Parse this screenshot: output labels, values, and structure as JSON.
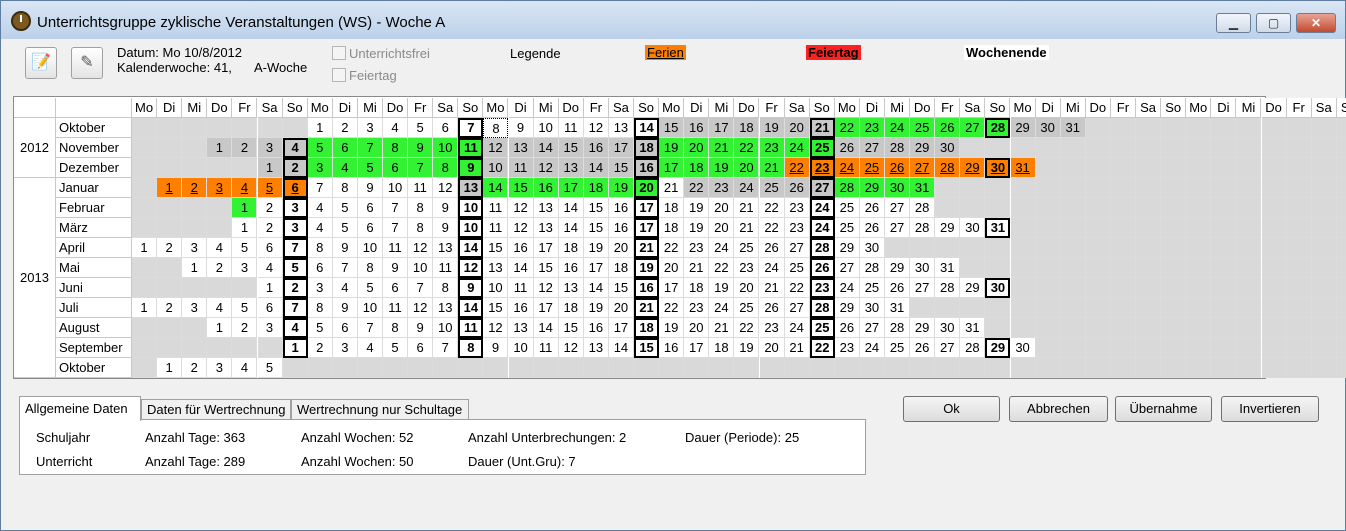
{
  "window": {
    "title": "Unterrichtsgruppe zyklische Veranstaltungen (WS) - Woche A",
    "minimize": "▁",
    "maximize": "▢",
    "close": "✕"
  },
  "toolbar": {
    "datum": "Datum: Mo 10/8/2012",
    "kalenderwoche": "Kalenderwoche: 41,",
    "woche": "A-Woche",
    "unterrichtsfrei": "Unterrichtsfrei",
    "feiertag_cb": "Feiertag",
    "legende": "Legende",
    "ferien": "Ferien",
    "feiertag": "Feiertag",
    "wochenende": "Wochenende",
    "icon1": "notepad-icon",
    "icon2": "pencil-icon"
  },
  "calendar": {
    "weekday_headers": [
      "Mo",
      "Di",
      "Mi",
      "Do",
      "Fr",
      "Sa",
      "So",
      "Mo",
      "Di",
      "Mi",
      "Do",
      "Fr",
      "Sa",
      "So",
      "Mo",
      "Di",
      "Mi",
      "Do",
      "Fr",
      "Sa",
      "So",
      "Mo",
      "Di",
      "Mi",
      "Do",
      "Fr",
      "Sa",
      "So",
      "Mo",
      "Di",
      "Mi",
      "Do",
      "Fr",
      "Sa",
      "So",
      "Mo",
      "Di",
      "Mi",
      "Do",
      "Fr",
      "Sa",
      "So",
      "Mo",
      "Di",
      "Mi",
      "Do",
      "Fr",
      "Sa",
      "So"
    ],
    "years": [
      {
        "label": "2012",
        "rows": 3
      },
      {
        "label": "2013",
        "rows": 10
      }
    ],
    "months": [
      {
        "name": "Oktober",
        "offset": 7,
        "days": 31,
        "green": [
          22,
          23,
          24,
          25,
          26,
          27,
          28
        ],
        "orange": [],
        "grey": [
          15,
          16,
          17,
          18,
          19,
          20,
          21,
          29,
          30,
          31
        ],
        "today": 8
      },
      {
        "name": "November",
        "offset": 3,
        "days": 30,
        "green": [
          5,
          6,
          7,
          8,
          9,
          10,
          11,
          19,
          20,
          21,
          22,
          23,
          24,
          25
        ],
        "orange": [],
        "grey": [
          1,
          2,
          3,
          4,
          12,
          13,
          14,
          15,
          16,
          17,
          18,
          26,
          27,
          28,
          29,
          30
        ]
      },
      {
        "name": "Dezember",
        "offset": 5,
        "days": 31,
        "green": [
          3,
          4,
          5,
          6,
          7,
          8,
          9,
          17,
          18,
          19,
          20,
          21
        ],
        "orange": [
          22,
          23,
          24,
          25,
          26,
          27,
          28,
          29,
          30,
          31
        ],
        "grey": [
          1,
          2,
          10,
          11,
          12,
          13,
          14,
          15,
          16
        ]
      },
      {
        "name": "Januar",
        "offset": 1,
        "days": 31,
        "green": [
          14,
          15,
          16,
          17,
          18,
          19,
          20,
          28,
          29,
          30,
          31
        ],
        "orange": [
          1,
          2,
          3,
          4,
          5,
          6
        ],
        "grey": [
          13,
          22,
          23,
          24,
          25,
          26,
          27
        ]
      },
      {
        "name": "Februar",
        "offset": 4,
        "days": 28,
        "green": [
          1
        ],
        "orange": [],
        "grey": []
      },
      {
        "name": "März",
        "offset": 4,
        "days": 31,
        "green": [],
        "orange": [],
        "grey": []
      },
      {
        "name": "April",
        "offset": 0,
        "days": 30,
        "green": [],
        "orange": [],
        "grey": []
      },
      {
        "name": "Mai",
        "offset": 2,
        "days": 31,
        "green": [],
        "orange": [],
        "grey": []
      },
      {
        "name": "Juni",
        "offset": 5,
        "days": 30,
        "green": [],
        "orange": [],
        "grey": []
      },
      {
        "name": "Juli",
        "offset": 0,
        "days": 31,
        "green": [],
        "orange": [],
        "grey": []
      },
      {
        "name": "August",
        "offset": 3,
        "days": 31,
        "green": [],
        "orange": [],
        "grey": []
      },
      {
        "name": "September",
        "offset": 6,
        "days": 30,
        "green": [],
        "orange": [],
        "grey": []
      },
      {
        "name": "Oktober",
        "offset": 1,
        "days": 5,
        "green": [],
        "orange": [],
        "grey": []
      }
    ]
  },
  "tabs": [
    "Allgemeine Daten",
    "Daten für Wertrechnung",
    "Wertrechnung nur Schultage"
  ],
  "info": {
    "schuljahr": "Schuljahr",
    "schuljahr_tage": "Anzahl Tage: 363",
    "schuljahr_wochen": "Anzahl Wochen: 52",
    "unterbrechungen": "Anzahl Unterbrechungen: 2",
    "dauer_periode": "Dauer (Periode): 25",
    "unterricht": "Unterricht",
    "unterricht_tage": "Anzahl Tage: 289",
    "unterricht_wochen": "Anzahl Wochen: 50",
    "dauer_untgru": "Dauer (Unt.Gru): 7"
  },
  "buttons": {
    "ok": "Ok",
    "abbrechen": "Abbrechen",
    "uebernahme": "Übernahme",
    "invertieren": "Invertieren"
  }
}
